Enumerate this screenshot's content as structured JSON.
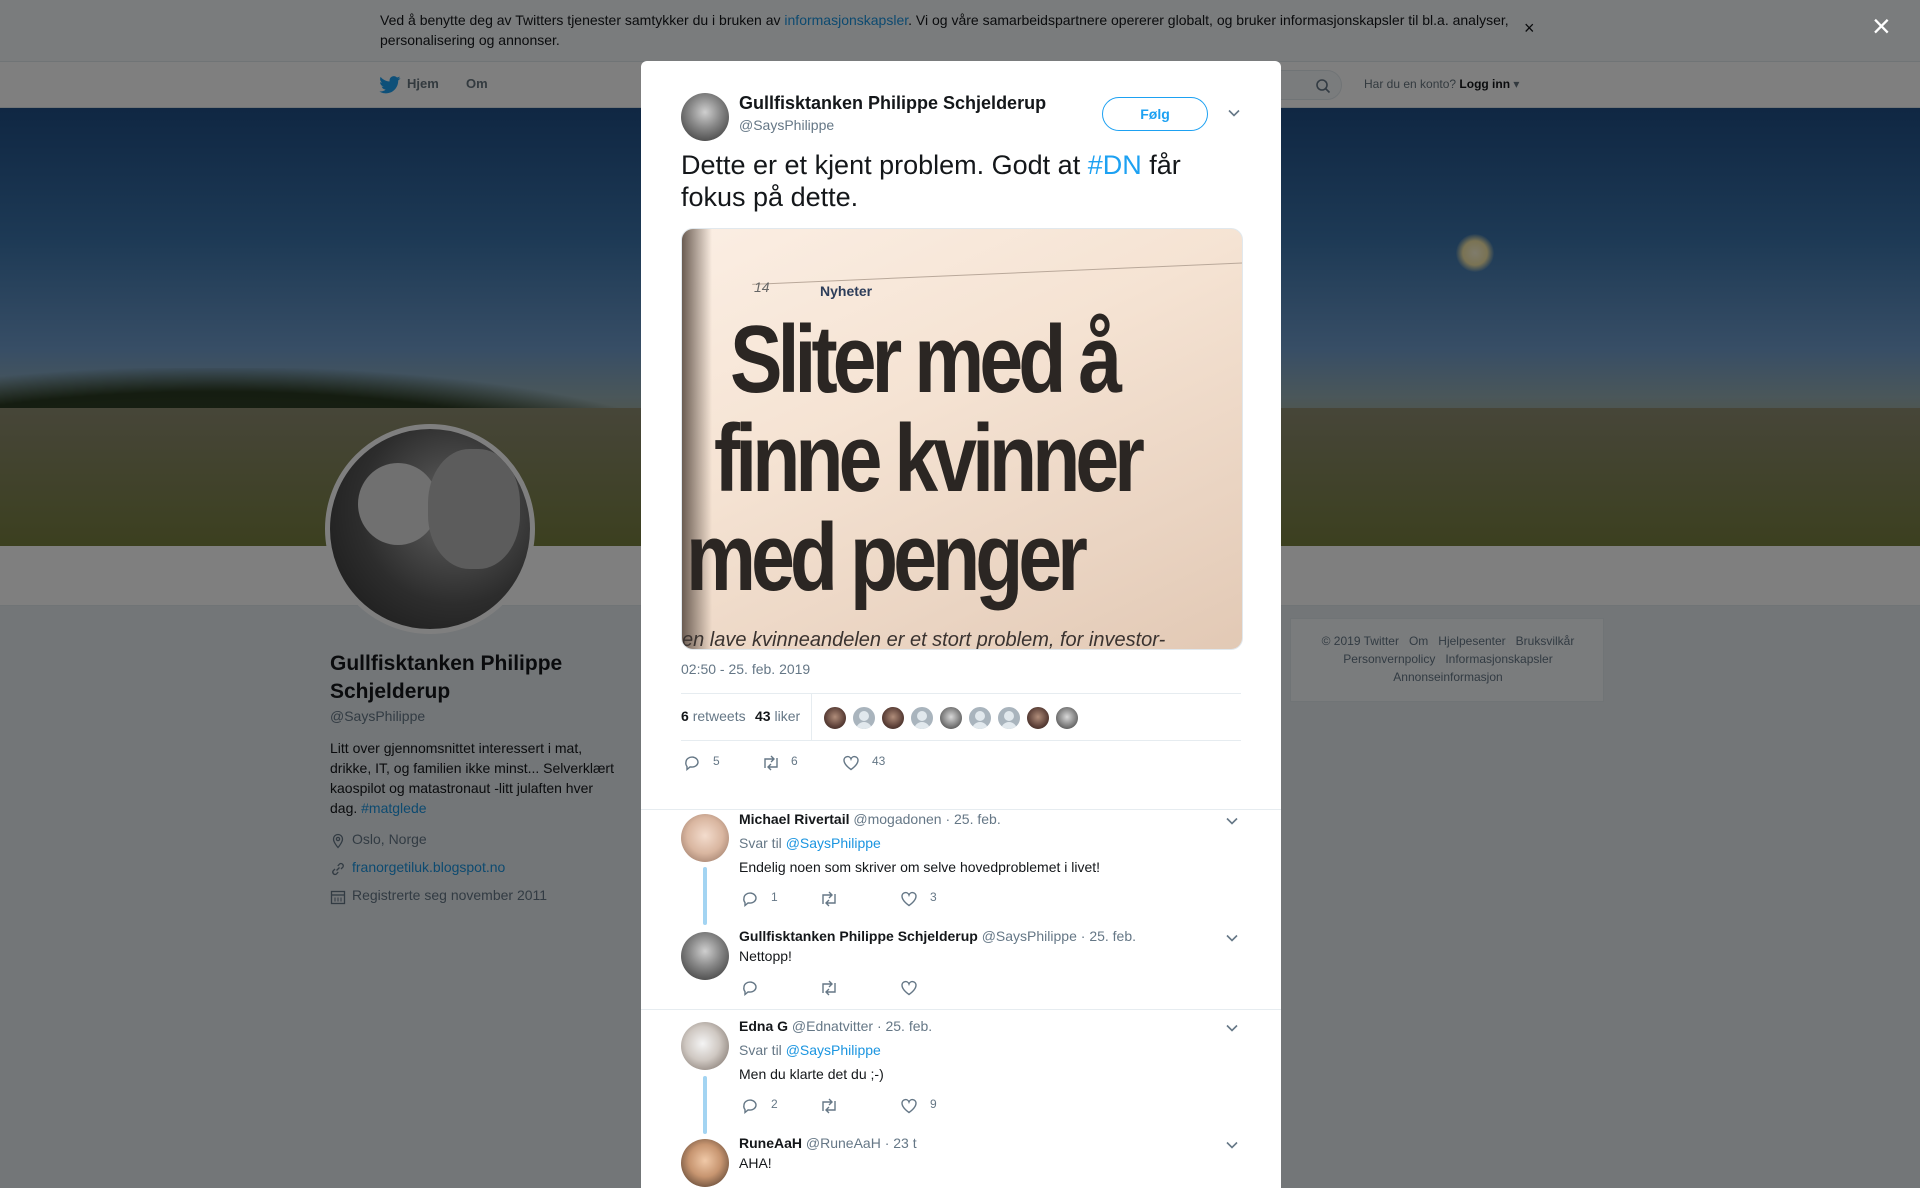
{
  "cookie": {
    "text_before": "Ved å benytte deg av Twitters tjenester samtykker du i bruken av ",
    "link": "informasjonskapsler",
    "text_after": ". Vi og våre samarbeidspartnere opererer globalt, og bruker informasjonskapsler til bl.a. analyser, personalisering og annonser.",
    "close": "×"
  },
  "nav": {
    "home": "Hjem",
    "about": "Om",
    "has_account": "Har du en konto?",
    "login": "Logg inn"
  },
  "profile": {
    "name": "Gullfisktanken Philippe Schjelderup",
    "handle": "@SaysPhilippe",
    "bio": "Litt over gjennomsnittet interessert i mat, drikke, IT, og familien ikke minst... Selverklært kaospilot og matastronaut -litt julaften hver dag. ",
    "bio_tag": "#matglede",
    "location": "Oslo, Norge",
    "website": "franorgetiluk.blogspot.no",
    "joined": "Registrerte seg november 2011"
  },
  "footer": {
    "row1": [
      "© 2019 Twitter",
      "Om",
      "Hjelpesenter",
      "Bruksvilkår"
    ],
    "row2": [
      "Personvernpolicy",
      "Informasjonskapsler"
    ],
    "row3": [
      "Annonseinformasjon"
    ]
  },
  "overlay_close": "×",
  "tweet": {
    "name": "Gullfisktanken Philippe Schjelderup",
    "handle": "@SaysPhilippe",
    "follow": "Følg",
    "text_before": "Dette er et kjent problem. Godt at ",
    "hashtag": "#DN",
    "text_after": " får fokus på dette.",
    "image": {
      "page_no": "14",
      "section": "Nyheter",
      "headline": [
        "Sliter med å",
        "finne kvinner",
        "med penger"
      ],
      "subline": "en lave kvinneandelen er et stort problem, for investor-"
    },
    "time": "02:50 - 25. feb. 2019",
    "retweets_count": "6",
    "retweets_label": "retweets",
    "likes_count": "43",
    "likes_label": "liker",
    "actions": {
      "replies": "5",
      "retweets": "6",
      "likes": "43"
    }
  },
  "replies": [
    {
      "name": "Michael Rivertail",
      "handle": "@mogadonen",
      "date": "· 25. feb.",
      "reply_to_label": "Svar til",
      "reply_to": "@SaysPhilippe",
      "text": "Endelig noen som skriver om selve hovedproblemet i livet!",
      "replies": "1",
      "retweets": "",
      "likes": "3"
    },
    {
      "name": "Gullfisktanken Philippe Schjelderup",
      "handle": "@SaysPhilippe",
      "date": "· 25. feb.",
      "text": "Nettopp!",
      "replies": "",
      "retweets": "",
      "likes": ""
    },
    {
      "name": "Edna G",
      "handle": "@Ednatvitter",
      "date": "· 25. feb.",
      "reply_to_label": "Svar til",
      "reply_to": "@SaysPhilippe",
      "text": "Men du klarte det du ;-)",
      "replies": "2",
      "retweets": "",
      "likes": "9"
    },
    {
      "name": "RuneAaH",
      "handle": "@RuneAaH",
      "date": "· 23 t",
      "text": "AHA!"
    }
  ],
  "colors": {
    "accent": "#1da1f2",
    "link": "#1b95e0",
    "thread": "#a3d4f2"
  },
  "icons": [
    "twitter-bird-icon",
    "search-icon",
    "location-icon",
    "link-icon",
    "calendar-icon",
    "reply-icon",
    "retweet-icon",
    "heart-icon",
    "chevron-down-icon",
    "close-icon"
  ]
}
